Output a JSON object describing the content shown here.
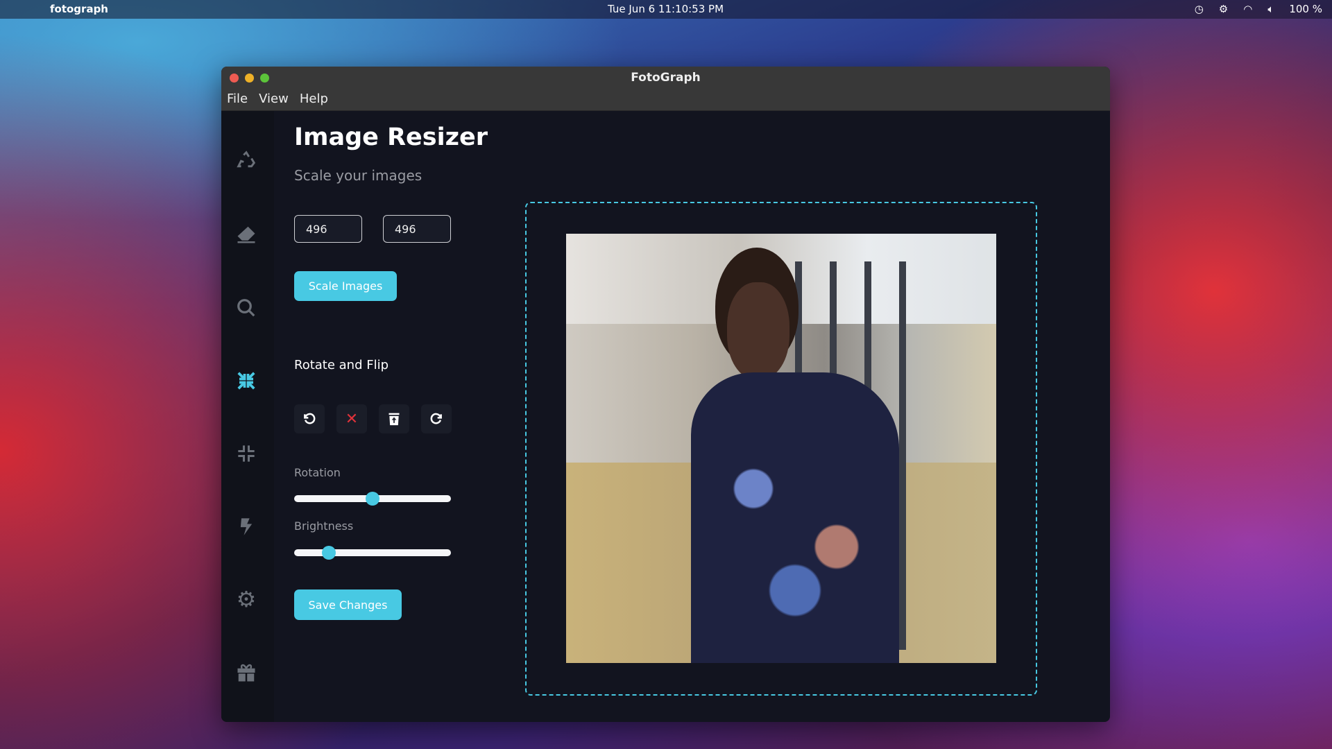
{
  "menubar": {
    "app_name": "fotograph",
    "clock": "Tue Jun 6  11:10:53 PM",
    "battery": "100 %"
  },
  "window": {
    "title": "FotoGraph",
    "menu": [
      "File",
      "View",
      "Help"
    ]
  },
  "sidebar": {
    "items": [
      {
        "icon": "recycle-icon"
      },
      {
        "icon": "eraser-icon"
      },
      {
        "icon": "search-icon"
      },
      {
        "icon": "compress-arrows-icon",
        "active": true
      },
      {
        "icon": "compress-icon"
      },
      {
        "icon": "bolt-icon"
      },
      {
        "icon": "gear-icon"
      },
      {
        "icon": "gift-icon"
      }
    ]
  },
  "main": {
    "title": "Image Resizer",
    "subtitle": "Scale your images",
    "width_value": "496",
    "height_value": "496",
    "scale_label": "Scale Images",
    "rotate_heading": "Rotate and Flip",
    "rotation_label": "Rotation",
    "rotation_value": 0.5,
    "brightness_label": "Brightness",
    "brightness_value": 0.22,
    "save_label": "Save Changes"
  },
  "colors": {
    "accent": "#48c9e3",
    "danger": "#e0323a"
  }
}
